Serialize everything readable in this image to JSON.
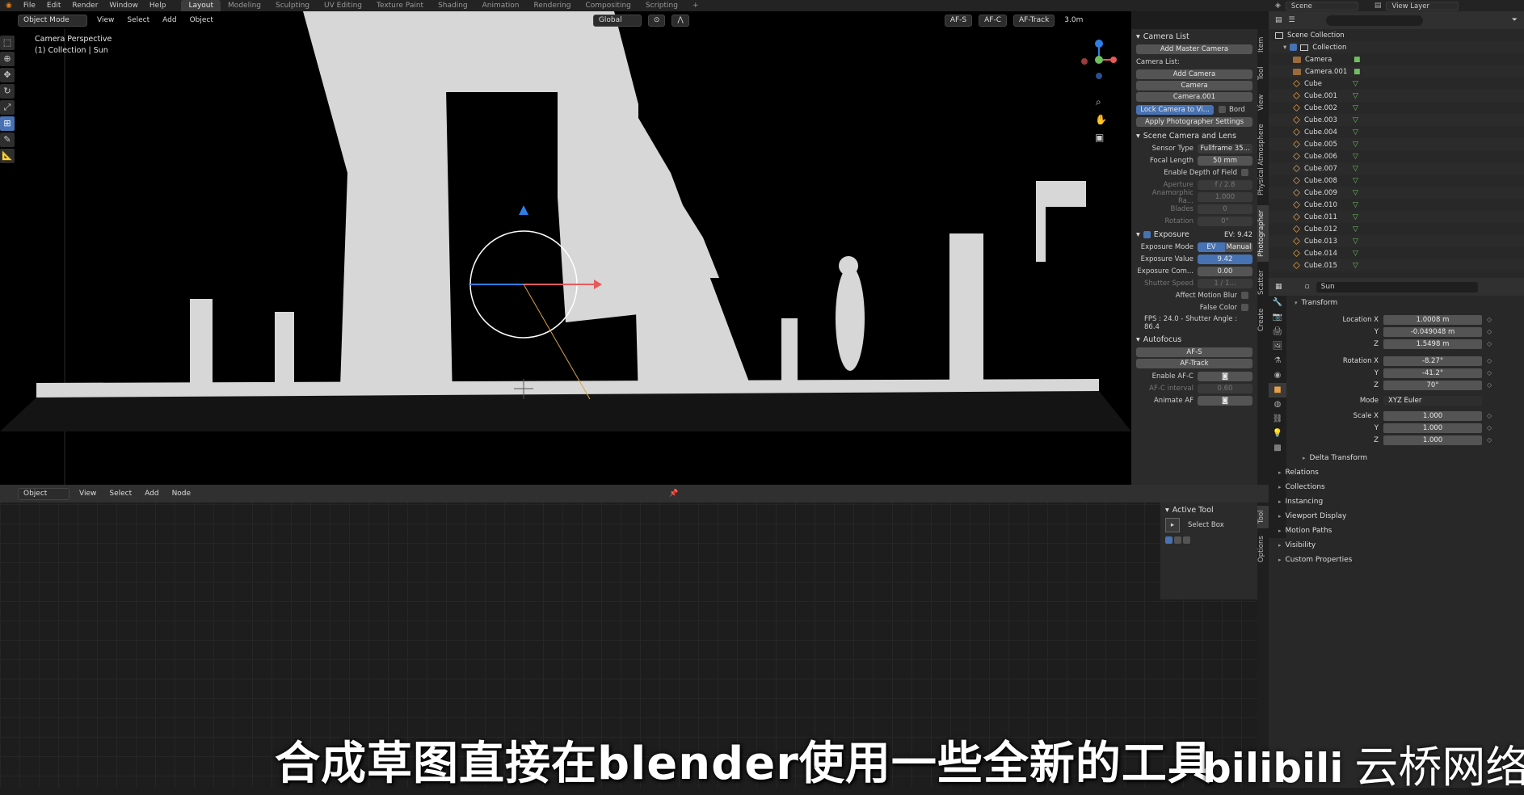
{
  "menubar": {
    "items": [
      "File",
      "Edit",
      "Render",
      "Window",
      "Help"
    ],
    "workspaces": [
      "Layout",
      "Modeling",
      "Sculpting",
      "UV Editing",
      "Texture Paint",
      "Shading",
      "Animation",
      "Rendering",
      "Compositing",
      "Scripting"
    ],
    "active_workspace": "Layout",
    "add_tab": "+",
    "scene": "Scene",
    "view_layer": "View Layer"
  },
  "viewport": {
    "mode": "Object Mode",
    "menus": [
      "View",
      "Select",
      "Add",
      "Object"
    ],
    "transform_orientation": "Global",
    "header_right": [
      "AF-S",
      "AF-C",
      "AF-Track",
      "3.0m"
    ],
    "info_line1": "Camera Perspective",
    "info_line2": "(1) Collection | Sun"
  },
  "npanel": {
    "camera_list_title": "Camera List",
    "add_master_camera": "Add Master Camera",
    "camera_list_label": "Camera List:",
    "add_camera": "Add Camera",
    "cameras": [
      "Camera",
      "Camera.001"
    ],
    "lock_camera": "Lock Camera to Vi...",
    "bord": "Bord",
    "apply_settings": "Apply Photographer Settings",
    "scene_camera_title": "Scene Camera and Lens",
    "sensor_type_label": "Sensor Type",
    "sensor_type": "Fullframe 35...",
    "focal_length_label": "Focal Length",
    "focal_length": "50 mm",
    "dof_label": "Enable Depth of Field",
    "aperture_label": "Aperture",
    "aperture": "f / 2.8",
    "anamorphic_label": "Anamorphic Ra...",
    "anamorphic": "1.000",
    "blades_label": "Blades",
    "blades": "0",
    "rotation_label": "Rotation",
    "rotation": "0°",
    "exposure_title": "Exposure",
    "ev_display": "EV: 9.42",
    "exposure_mode_label": "Exposure Mode",
    "exposure_mode_ev": "EV",
    "exposure_mode_manual": "Manual",
    "exposure_value_label": "Exposure Value",
    "exposure_value": "9.42",
    "exposure_comp_label": "Exposure Com...",
    "exposure_comp": "0.00",
    "shutter_speed_label": "Shutter Speed",
    "shutter_speed": "1 / 1...",
    "motion_blur_label": "Affect Motion Blur",
    "false_color_label": "False Color",
    "fps_line": "FPS : 24.0 - Shutter Angle : 86.4",
    "autofocus_title": "Autofocus",
    "af_s": "AF-S",
    "af_track": "AF-Track",
    "enable_afc_label": "Enable AF-C",
    "afc_interval_label": "AF-C interval",
    "afc_interval": "0.60",
    "animate_af_label": "Animate AF"
  },
  "vtabs": [
    "Item",
    "Tool",
    "View",
    "Physical Atmosphere",
    "Photographer",
    "Scatter",
    "Create"
  ],
  "outliner": {
    "scene_collection": "Scene Collection",
    "collection": "Collection",
    "items": [
      "Camera",
      "Camera.001",
      "Cube",
      "Cube.001",
      "Cube.002",
      "Cube.003",
      "Cube.004",
      "Cube.005",
      "Cube.006",
      "Cube.007",
      "Cube.008",
      "Cube.009",
      "Cube.010",
      "Cube.011",
      "Cube.012",
      "Cube.013",
      "Cube.014",
      "Cube.015"
    ]
  },
  "properties": {
    "object_name": "Sun",
    "transform_title": "Transform",
    "location_label": "Location X",
    "location": [
      "1.0008 m",
      "-0.049048 m",
      "1.5498 m"
    ],
    "rotation_label": "Rotation X",
    "rotation": [
      "-8.27°",
      "-41.2°",
      "70°"
    ],
    "mode_label": "Mode",
    "mode": "XYZ Euler",
    "scale_label": "Scale X",
    "scale": [
      "1.000",
      "1.000",
      "1.000"
    ],
    "axis_y": "Y",
    "axis_z": "Z",
    "delta_transform": "Delta Transform",
    "sections": [
      "Relations",
      "Collections",
      "Instancing",
      "Viewport Display",
      "Motion Paths",
      "Visibility",
      "Custom Properties"
    ]
  },
  "node_editor": {
    "type": "Object",
    "menus": [
      "View",
      "Select",
      "Add",
      "Node"
    ],
    "active_tool_title": "Active Tool",
    "active_tool": "Select Box",
    "tabs": [
      "Tool",
      "Options"
    ]
  },
  "overlay": {
    "subtitle": "合成草图直接在blender使用一些全新的工具",
    "logo": "bilibili",
    "channel": "云桥网络"
  }
}
